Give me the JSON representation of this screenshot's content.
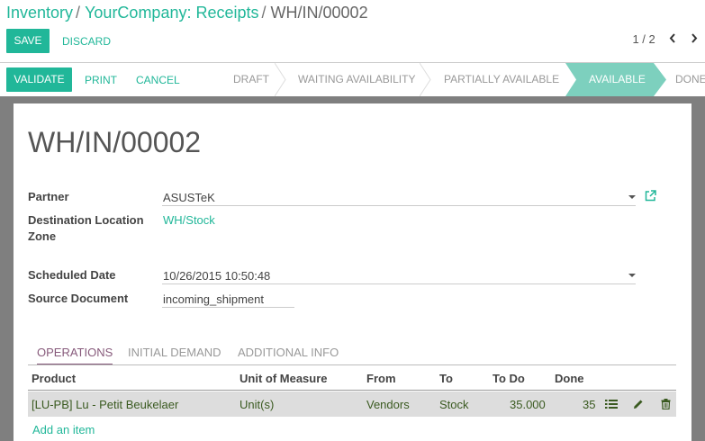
{
  "breadcrumb": {
    "root": "Inventory",
    "parent": "YourCompany: Receipts",
    "current": "WH/IN/00002",
    "separator": "/"
  },
  "toolbar": {
    "save_label": "SAVE",
    "discard_label": "DISCARD"
  },
  "pager": {
    "value": "1 / 2",
    "prev": "‹",
    "next": "›"
  },
  "actions": {
    "validate": "VALIDATE",
    "print": "PRINT",
    "cancel": "CANCEL"
  },
  "stages": [
    "DRAFT",
    "WAITING AVAILABILITY",
    "PARTIALLY AVAILABLE",
    "AVAILABLE",
    "DONE"
  ],
  "active_stage": "AVAILABLE",
  "record": {
    "title": "WH/IN/00002",
    "partner_label": "Partner",
    "partner_value": "ASUSTeK",
    "dest_label_line1": "Destination Location",
    "dest_label_line2": "Zone",
    "dest_value": "WH/Stock",
    "date_label": "Scheduled Date",
    "date_value": "10/26/2015 10:50:48",
    "source_label": "Source Document",
    "source_value": "incoming_shipment"
  },
  "tabs": [
    "OPERATIONS",
    "INITIAL DEMAND",
    "ADDITIONAL INFO"
  ],
  "table": {
    "headers": [
      "Product",
      "Unit of Measure",
      "From",
      "To",
      "To Do",
      "Done"
    ],
    "rows": [
      {
        "product": "[LU-PB] Lu - Petit Beukelaer",
        "uom": "Unit(s)",
        "from": "Vendors",
        "to": "Stock",
        "todo": "35.000",
        "done": "35"
      }
    ],
    "add_item": "Add an item"
  },
  "colors": {
    "accent": "#21b799",
    "active_stage": "#7dd0be",
    "tab_active": "#875a7b"
  }
}
